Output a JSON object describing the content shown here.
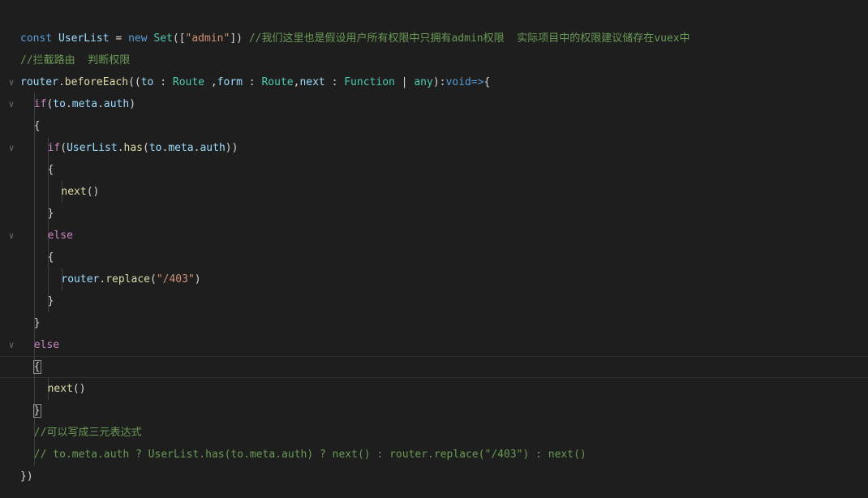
{
  "editor": {
    "lines": [
      {
        "fold": false,
        "indent": 0,
        "tokens": [
          {
            "t": "const ",
            "c": "kw"
          },
          {
            "t": "UserList",
            "c": "var"
          },
          {
            "t": " = ",
            "c": "pn"
          },
          {
            "t": "new ",
            "c": "kw"
          },
          {
            "t": "Set",
            "c": "type"
          },
          {
            "t": "([",
            "c": "pn"
          },
          {
            "t": "\"admin\"",
            "c": "str"
          },
          {
            "t": "]) ",
            "c": "pn"
          },
          {
            "t": "//我们这里也是假设用户所有权限中只拥有admin权限  实际项目中的权限建议储存在vuex中",
            "c": "cm"
          }
        ]
      },
      {
        "fold": false,
        "indent": 0,
        "tokens": [
          {
            "t": "//拦截路由  判断权限",
            "c": "cm"
          }
        ]
      },
      {
        "fold": true,
        "indent": 0,
        "tokens": [
          {
            "t": "router",
            "c": "var"
          },
          {
            "t": ".",
            "c": "pn"
          },
          {
            "t": "beforeEach",
            "c": "fn"
          },
          {
            "t": "((",
            "c": "pn"
          },
          {
            "t": "to",
            "c": "var"
          },
          {
            "t": " : ",
            "c": "pn"
          },
          {
            "t": "Route",
            "c": "type"
          },
          {
            "t": " ,",
            "c": "pn"
          },
          {
            "t": "form",
            "c": "var"
          },
          {
            "t": " : ",
            "c": "pn"
          },
          {
            "t": "Route",
            "c": "type"
          },
          {
            "t": ",",
            "c": "pn"
          },
          {
            "t": "next",
            "c": "var"
          },
          {
            "t": " : ",
            "c": "pn"
          },
          {
            "t": "Function",
            "c": "type"
          },
          {
            "t": " | ",
            "c": "pn"
          },
          {
            "t": "any",
            "c": "type"
          },
          {
            "t": "):",
            "c": "pn"
          },
          {
            "t": "void",
            "c": "kw"
          },
          {
            "t": "=>",
            "c": "kw"
          },
          {
            "t": "{",
            "c": "pn"
          }
        ]
      },
      {
        "fold": true,
        "indent": 1,
        "tokens": [
          {
            "t": "if",
            "c": "ctl"
          },
          {
            "t": "(",
            "c": "pn"
          },
          {
            "t": "to",
            "c": "var"
          },
          {
            "t": ".",
            "c": "pn"
          },
          {
            "t": "meta",
            "c": "var"
          },
          {
            "t": ".",
            "c": "pn"
          },
          {
            "t": "auth",
            "c": "var"
          },
          {
            "t": ")",
            "c": "pn"
          }
        ]
      },
      {
        "fold": false,
        "indent": 1,
        "tokens": [
          {
            "t": "{",
            "c": "pn"
          }
        ]
      },
      {
        "fold": true,
        "indent": 2,
        "tokens": [
          {
            "t": "if",
            "c": "ctl"
          },
          {
            "t": "(",
            "c": "pn"
          },
          {
            "t": "UserList",
            "c": "var"
          },
          {
            "t": ".",
            "c": "pn"
          },
          {
            "t": "has",
            "c": "fn"
          },
          {
            "t": "(",
            "c": "pn"
          },
          {
            "t": "to",
            "c": "var"
          },
          {
            "t": ".",
            "c": "pn"
          },
          {
            "t": "meta",
            "c": "var"
          },
          {
            "t": ".",
            "c": "pn"
          },
          {
            "t": "auth",
            "c": "var"
          },
          {
            "t": "))",
            "c": "pn"
          }
        ]
      },
      {
        "fold": false,
        "indent": 2,
        "tokens": [
          {
            "t": "{",
            "c": "pn"
          }
        ]
      },
      {
        "fold": false,
        "indent": 3,
        "tokens": [
          {
            "t": "next",
            "c": "fn"
          },
          {
            "t": "()",
            "c": "pn"
          }
        ]
      },
      {
        "fold": false,
        "indent": 2,
        "tokens": [
          {
            "t": "}",
            "c": "pn"
          }
        ]
      },
      {
        "fold": true,
        "indent": 2,
        "tokens": [
          {
            "t": "else",
            "c": "ctl"
          }
        ]
      },
      {
        "fold": false,
        "indent": 2,
        "tokens": [
          {
            "t": "{",
            "c": "pn"
          }
        ]
      },
      {
        "fold": false,
        "indent": 3,
        "tokens": [
          {
            "t": "router",
            "c": "var"
          },
          {
            "t": ".",
            "c": "pn"
          },
          {
            "t": "replace",
            "c": "fn"
          },
          {
            "t": "(",
            "c": "pn"
          },
          {
            "t": "\"/403\"",
            "c": "str"
          },
          {
            "t": ")",
            "c": "pn"
          }
        ]
      },
      {
        "fold": false,
        "indent": 2,
        "tokens": [
          {
            "t": "}",
            "c": "pn"
          }
        ]
      },
      {
        "fold": false,
        "indent": 1,
        "tokens": [
          {
            "t": "}",
            "c": "pn"
          }
        ]
      },
      {
        "fold": true,
        "indent": 1,
        "tokens": [
          {
            "t": "else",
            "c": "ctl"
          }
        ]
      },
      {
        "fold": false,
        "indent": 1,
        "active": true,
        "tokens": [
          {
            "t": "{",
            "c": "pn bm"
          }
        ]
      },
      {
        "fold": false,
        "indent": 2,
        "tokens": [
          {
            "t": "next",
            "c": "fn"
          },
          {
            "t": "()",
            "c": "pn"
          }
        ]
      },
      {
        "fold": false,
        "indent": 1,
        "tokens": [
          {
            "t": "}",
            "c": "pn bm"
          }
        ]
      },
      {
        "fold": false,
        "indent": 1,
        "tokens": [
          {
            "t": "//可以写成三元表达式",
            "c": "cm"
          }
        ]
      },
      {
        "fold": false,
        "indent": 1,
        "tokens": [
          {
            "t": "// to.meta.auth ? UserList.has(to.meta.auth) ? next() : router.replace(\"/403\") : next()",
            "c": "cm"
          }
        ]
      },
      {
        "fold": false,
        "indent": 0,
        "tokens": [
          {
            "t": "})",
            "c": "pn"
          }
        ]
      }
    ]
  },
  "icons": {
    "fold": "chevron-down-icon"
  },
  "colors": {
    "background": "#1e1e1e",
    "keyword": "#569cd6",
    "control": "#c586c0",
    "variable": "#9cdcfe",
    "function": "#dcdcaa",
    "type": "#4ec9b0",
    "string": "#ce9178",
    "comment": "#6a9955"
  }
}
